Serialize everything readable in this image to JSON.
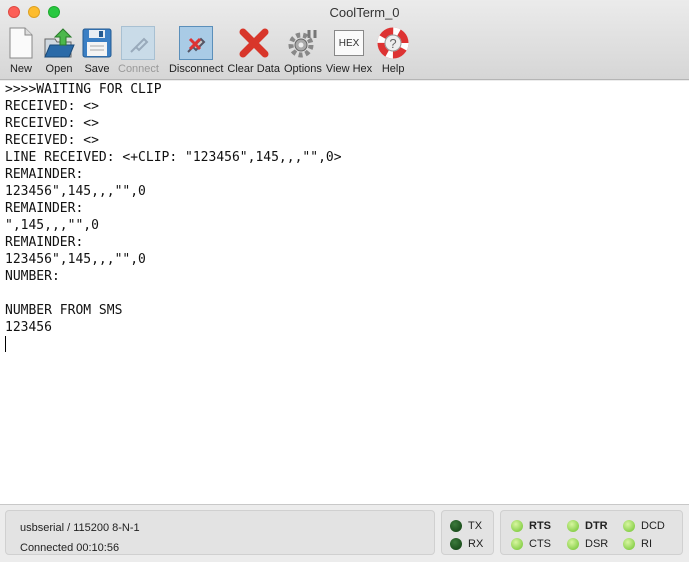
{
  "window": {
    "title": "CoolTerm_0"
  },
  "toolbar": [
    {
      "label": "New",
      "icon": "new-document-icon",
      "enabled": true
    },
    {
      "label": "Open",
      "icon": "open-folder-icon",
      "enabled": true
    },
    {
      "label": "Save",
      "icon": "floppy-disk-icon",
      "enabled": true
    },
    {
      "label": "Connect",
      "icon": "plug-icon",
      "enabled": false
    },
    {
      "label": "Disconnect",
      "icon": "unplug-icon",
      "enabled": true
    },
    {
      "label": "Clear Data",
      "icon": "red-x-icon",
      "enabled": true
    },
    {
      "label": "Options",
      "icon": "gear-wrench-icon",
      "enabled": true
    },
    {
      "label": "View Hex",
      "icon": "hex-icon",
      "enabled": true,
      "icon_text": "HEX"
    },
    {
      "label": "Help",
      "icon": "lifebuoy-icon",
      "enabled": true
    }
  ],
  "terminal": {
    "lines": [
      ">>>>WAITING FOR CLIP",
      "RECEIVED: <>",
      "RECEIVED: <>",
      "RECEIVED: <>",
      "LINE RECEIVED: <+CLIP: \"123456\",145,,,\"\",0>",
      "REMAINDER:",
      "123456\",145,,,\"\",0",
      "REMAINDER:",
      "\",145,,,\"\",0",
      "REMAINDER:",
      "123456\",145,,,\"\",0",
      "NUMBER:",
      "",
      "NUMBER FROM SMS",
      "123456"
    ]
  },
  "status": {
    "port": "usbserial / 115200 8-N-1",
    "connection": "Connected 00:10:56",
    "leds": {
      "tx": "TX",
      "rx": "RX",
      "rts": "RTS",
      "cts": "CTS",
      "dtr": "DTR",
      "dsr": "DSR",
      "dcd": "DCD",
      "ri": "RI"
    }
  }
}
